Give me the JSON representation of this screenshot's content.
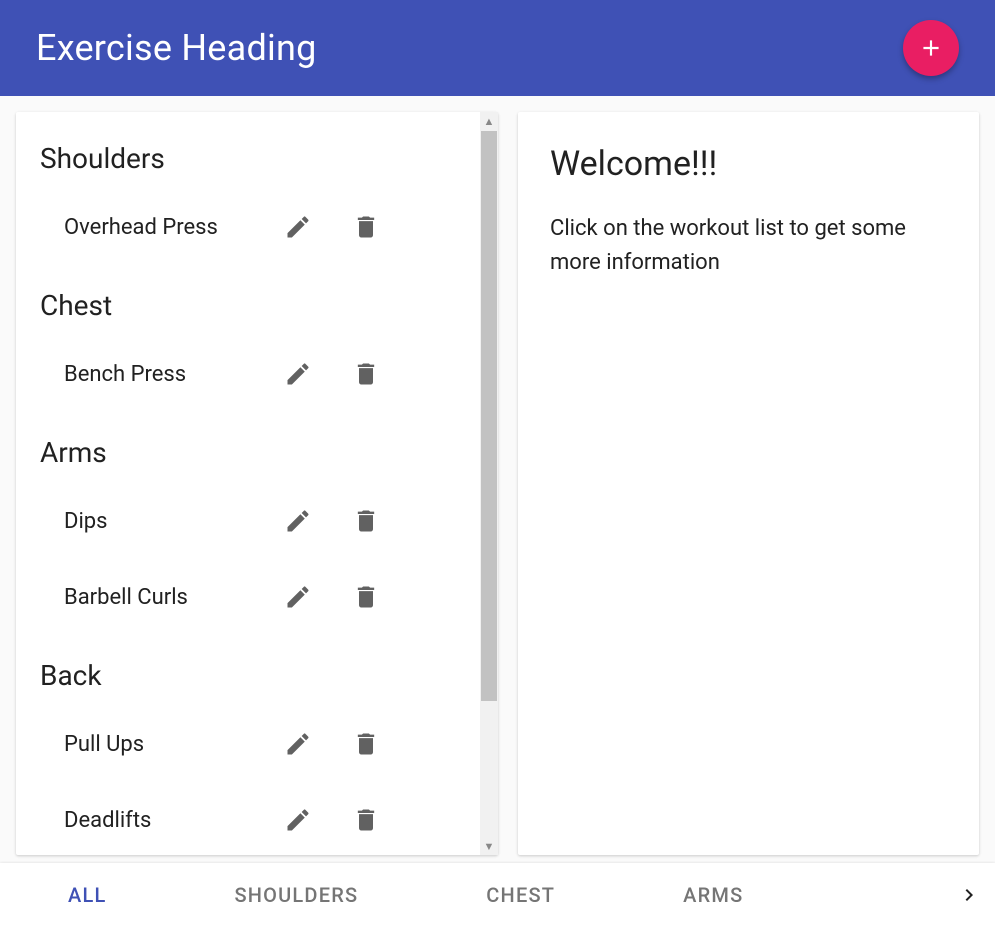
{
  "header": {
    "title": "Exercise Heading"
  },
  "groups": [
    {
      "name": "Shoulders",
      "exercises": [
        {
          "name": "Overhead Press"
        }
      ]
    },
    {
      "name": "Chest",
      "exercises": [
        {
          "name": "Bench Press"
        }
      ]
    },
    {
      "name": "Arms",
      "exercises": [
        {
          "name": "Dips"
        },
        {
          "name": "Barbell Curls"
        }
      ]
    },
    {
      "name": "Back",
      "exercises": [
        {
          "name": "Pull Ups"
        },
        {
          "name": "Deadlifts"
        }
      ]
    }
  ],
  "detail": {
    "title": "Welcome!!!",
    "body": "Click on the workout list to get some more information"
  },
  "tabs": {
    "active_index": 0,
    "items": [
      "ALL",
      "SHOULDERS",
      "CHEST",
      "ARMS"
    ]
  },
  "colors": {
    "primary": "#3f51b5",
    "accent": "#e91e63",
    "icon": "#616161"
  },
  "icons": {
    "add": "plus-icon",
    "edit": "pencil-icon",
    "delete": "trash-icon",
    "next": "chevron-right-icon",
    "scroll_up": "scroll-up-arrow",
    "scroll_down": "scroll-down-arrow"
  }
}
